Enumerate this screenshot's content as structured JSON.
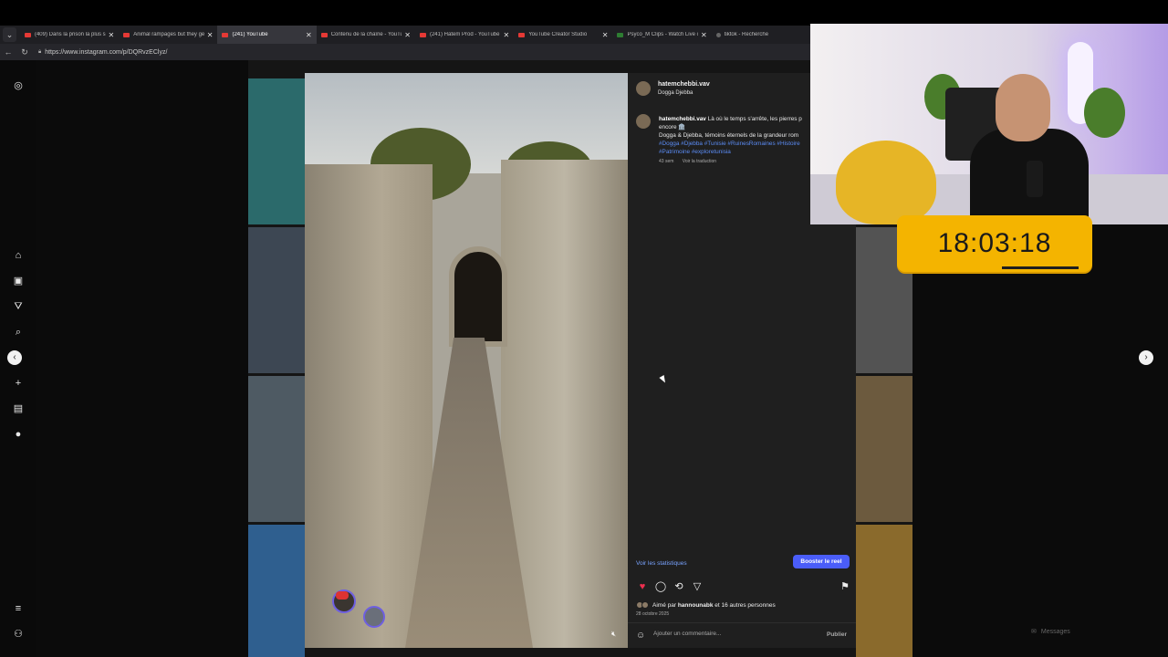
{
  "browser": {
    "tabs": [
      {
        "title": "(409) Dans la prison la plus surp",
        "favicon": "youtube-icon",
        "active": false
      },
      {
        "title": "Animal rampages but they get",
        "favicon": "youtube-icon",
        "active": false
      },
      {
        "title": "(241) YouTube",
        "favicon": "youtube-icon",
        "active": true
      },
      {
        "title": "Contenu de la chaîne - YouTube",
        "favicon": "youtube-icon",
        "active": false
      },
      {
        "title": "(241) Hatem Prod - YouTube",
        "favicon": "youtube-icon",
        "active": false
      },
      {
        "title": "YouTube Creator Studio",
        "favicon": "youtube-icon",
        "active": false
      },
      {
        "title": "Psyco_M Clips - Watch Live on",
        "favicon": "kick-icon",
        "active": false
      },
      {
        "title": "tiktok - Recherche",
        "favicon": "search-icon",
        "active": false
      }
    ],
    "url": "https://www.instagram.com/p/DQRvzEClyz/"
  },
  "post": {
    "username": "hatemchebbi.vav",
    "location": "Dogga Djebba",
    "caption_prefix": "Là où le temps s'arrête, les pierres p",
    "caption_line2": "encore 🏛️",
    "caption_line3": "Dogga & Djebba, témoins éternels de la grandeur rom",
    "hashtags_line1": "#Dogga #Djebba #Tunisie #RuinesRomaines #Histoire",
    "hashtags_line2": "#Patrimoine #exploretunisia",
    "age": "43 sem",
    "translate_label": "Voir la traduction",
    "stats_link": "Voir les statistiques",
    "boost_label": "Booster le reel",
    "liked_by_prefix": "Aimé par",
    "liked_by_user": "hannounabk",
    "liked_by_suffix": "et 16 autres personnes",
    "date": "28 octobre 2025",
    "comment_placeholder": "Ajouter un commentaire...",
    "publish_label": "Publier"
  },
  "sidebar": {
    "messages_label": "Messages"
  },
  "overlay": {
    "clock": "18:03:18"
  }
}
